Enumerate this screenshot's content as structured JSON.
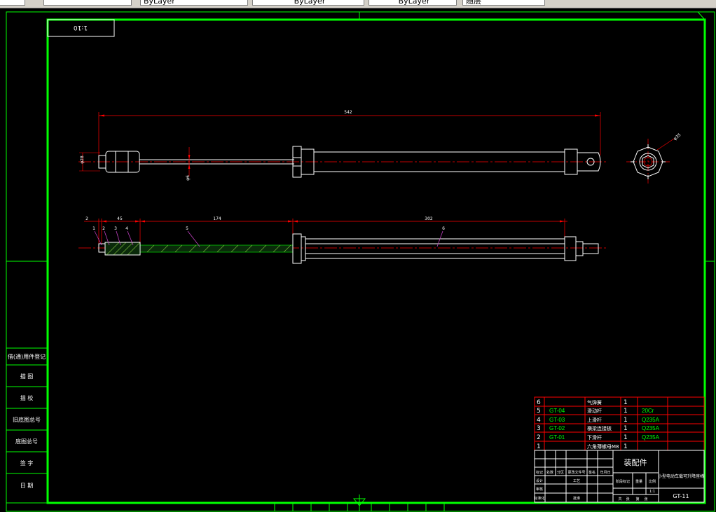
{
  "toolbar": {
    "fields": [
      "",
      "",
      "ByLayer",
      "ByLayer",
      "ByLayer",
      "随层"
    ]
  },
  "drawing": {
    "scale_box": "1:10"
  },
  "dimensions": {
    "overall_length": "542",
    "rod_diameter": "φ6",
    "head_diameter": "φ28",
    "end_view_diameter": "φ35",
    "gap": "2",
    "nut_length": "45",
    "rod_length": "174",
    "tube_length": "302"
  },
  "balloons": [
    "1",
    "2",
    "3",
    "4",
    "5",
    "6"
  ],
  "side_panel": {
    "rows": [
      "借(通)用件登记",
      "描 图",
      "描 校",
      "旧底图总号",
      "底图总号",
      "签 字",
      "日 期"
    ]
  },
  "bom": {
    "rows": [
      {
        "no": "6",
        "code": "",
        "name": "气弹簧",
        "qty": "1",
        "material": ""
      },
      {
        "no": "5",
        "code": "GT-04",
        "name": "滑动杆",
        "qty": "1",
        "material": "20Cr"
      },
      {
        "no": "4",
        "code": "GT-03",
        "name": "上滑杆",
        "qty": "1",
        "material": "Q235A"
      },
      {
        "no": "3",
        "code": "GT-02",
        "name": "横梁连接板",
        "qty": "1",
        "material": "Q235A"
      },
      {
        "no": "2",
        "code": "GT-01",
        "name": "下滑杆",
        "qty": "1",
        "material": "Q235A"
      },
      {
        "no": "1",
        "code": "",
        "name": "六角薄螺母M8",
        "qty": "1",
        "material": ""
      }
    ]
  },
  "title_block": {
    "assembly_label": "装配件",
    "design_title": "小型电动车载可升降座椅",
    "drawing_no": "GT-11",
    "header_labels": [
      "标记",
      "处数",
      "分区",
      "更改文件号",
      "签名",
      "年月日"
    ],
    "role_labels": [
      "设计",
      "审核",
      "工艺",
      "标准化",
      "批准"
    ],
    "stage_labels": [
      "阶段标记",
      "重量",
      "比例"
    ],
    "scale_value": "1:1",
    "sheet_labels": [
      "共",
      "张",
      "第",
      "张"
    ]
  }
}
